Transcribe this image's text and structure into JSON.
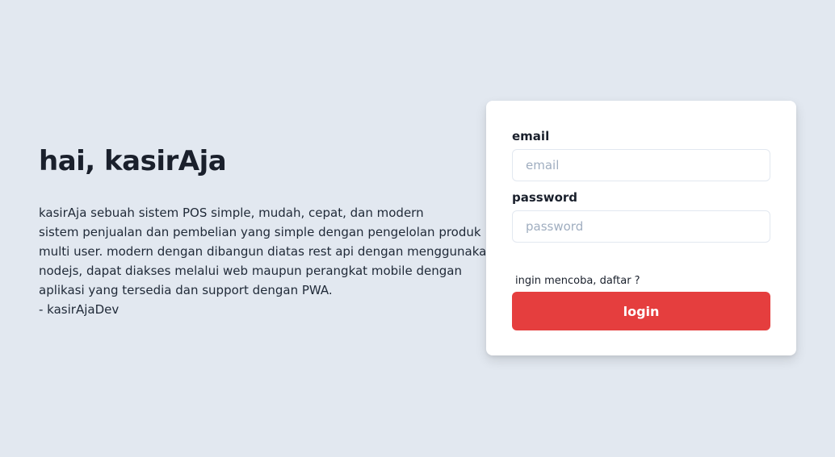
{
  "hero": {
    "title": "hai, kasirAja",
    "description_lines": [
      "kasirAja sebuah sistem POS simple, mudah, cepat, dan modern",
      "sistem penjualan dan pembelian yang simple dengan pengelolan produk",
      "multi user. modern dengan dibangun diatas rest api dengan menggunakan",
      "nodejs, dapat diakses melalui web maupun perangkat mobile dengan",
      "aplikasi yang tersedia dan support dengan PWA.",
      "- kasirAjaDev"
    ]
  },
  "login_form": {
    "email_label": "email",
    "email_placeholder": "email",
    "email_value": "",
    "password_label": "password",
    "password_placeholder": "password",
    "password_value": "",
    "signup_link": "ingin mencoba, daftar ?",
    "login_button": "login"
  },
  "colors": {
    "background": "#e2e8f0",
    "card": "#ffffff",
    "accent": "#e53e3e",
    "input_border": "#e2e8f0",
    "placeholder": "#a0aec0"
  }
}
